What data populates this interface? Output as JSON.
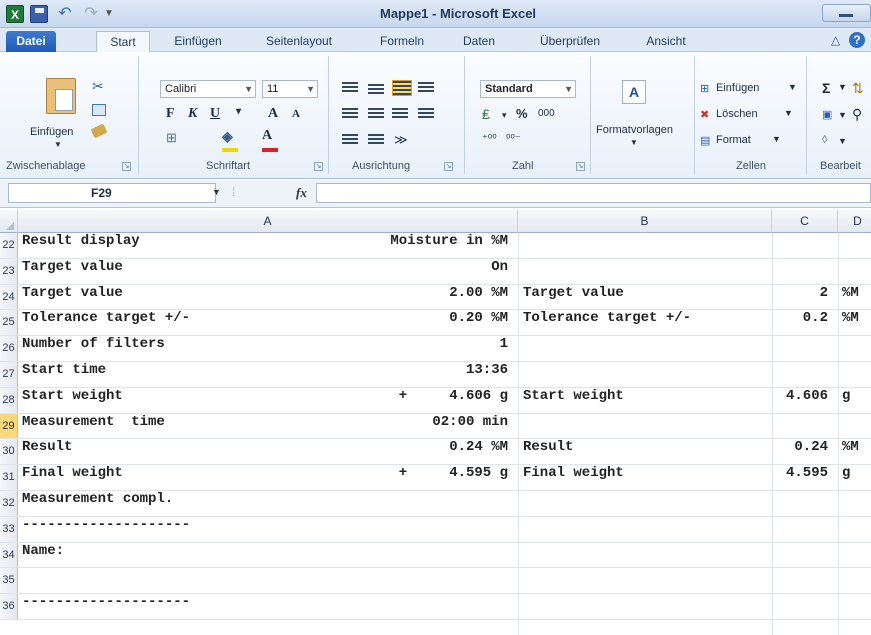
{
  "window": {
    "title": "Mappe1 - Microsoft Excel",
    "app_icon": "X"
  },
  "quick_access": {
    "icons": [
      "save-icon",
      "undo-icon",
      "redo-icon",
      "qat-more-icon"
    ]
  },
  "tabs": [
    "Datei",
    "Start",
    "Einfügen",
    "Seitenlayout",
    "Formeln",
    "Daten",
    "Überprüfen",
    "Ansicht"
  ],
  "ribbon": {
    "clipboard": {
      "paste_label": "Einfügen",
      "group_label": "Zwischenablage"
    },
    "font": {
      "name": "Calibri",
      "size": "11",
      "bold": "F",
      "italic": "K",
      "underline": "U",
      "grow": "A",
      "shrink": "A",
      "color_letter": "A",
      "group_label": "Schriftart"
    },
    "alignment": {
      "group_label": "Ausrichtung"
    },
    "number": {
      "format": "Standard",
      "percent": "%",
      "thousands": "000",
      "group_label": "Zahl"
    },
    "styles": {
      "label": "Formatvorlagen"
    },
    "cells": {
      "insert": "Einfügen",
      "delete": "Löschen",
      "format": "Format",
      "group_label": "Zellen"
    },
    "editing": {
      "sigma": "Σ",
      "group_label": "Bearbeit"
    }
  },
  "formula_bar": {
    "name_box": "F29",
    "fx": "fx",
    "formula": ""
  },
  "columns": [
    "A",
    "B",
    "C",
    "D"
  ],
  "active_row": 29,
  "rows": [
    {
      "num": "22",
      "a_label": "Result display",
      "a_value": "Moisture in %M",
      "b_label": "",
      "c_value": "",
      "d_unit": ""
    },
    {
      "num": "23",
      "a_label": "Target value",
      "a_value": "On",
      "b_label": "",
      "c_value": "",
      "d_unit": ""
    },
    {
      "num": "24",
      "a_label": "Target value",
      "a_value": "2.00 %M",
      "b_label": "Target value",
      "c_value": "2",
      "d_unit": "%M"
    },
    {
      "num": "25",
      "a_label": "Tolerance target +/-",
      "a_value": "0.20 %M",
      "b_label": "Tolerance target +/-",
      "c_value": "0.2",
      "d_unit": "%M"
    },
    {
      "num": "26",
      "a_label": "Number of filters",
      "a_value": "1",
      "b_label": "",
      "c_value": "",
      "d_unit": ""
    },
    {
      "num": "27",
      "a_label": "Start time",
      "a_value": "13:36",
      "b_label": "",
      "c_value": "",
      "d_unit": ""
    },
    {
      "num": "28",
      "a_label": "Start weight",
      "a_value": "+     4.606 g",
      "b_label": "Start weight",
      "c_value": "4.606",
      "d_unit": "g"
    },
    {
      "num": "29",
      "a_label": "Measurement  time",
      "a_value": "02:00 min",
      "b_label": "",
      "c_value": "",
      "d_unit": ""
    },
    {
      "num": "30",
      "a_label": "Result",
      "a_value": "0.24 %M",
      "b_label": "Result",
      "c_value": "0.24",
      "d_unit": "%M"
    },
    {
      "num": "31",
      "a_label": "Final weight",
      "a_value": "+     4.595 g",
      "b_label": "Final weight",
      "c_value": "4.595",
      "d_unit": "g"
    },
    {
      "num": "32",
      "a_label": "Measurement compl.",
      "a_value": "",
      "b_label": "",
      "c_value": "",
      "d_unit": ""
    },
    {
      "num": "33",
      "a_label": "--------------------",
      "a_value": "",
      "b_label": "",
      "c_value": "",
      "d_unit": ""
    },
    {
      "num": "34",
      "a_label": "Name:",
      "a_value": "",
      "b_label": "",
      "c_value": "",
      "d_unit": ""
    },
    {
      "num": "35",
      "a_label": "",
      "a_value": "",
      "b_label": "",
      "c_value": "",
      "d_unit": ""
    },
    {
      "num": "36",
      "a_label": "--------------------",
      "a_value": "",
      "b_label": "",
      "c_value": "",
      "d_unit": ""
    }
  ]
}
